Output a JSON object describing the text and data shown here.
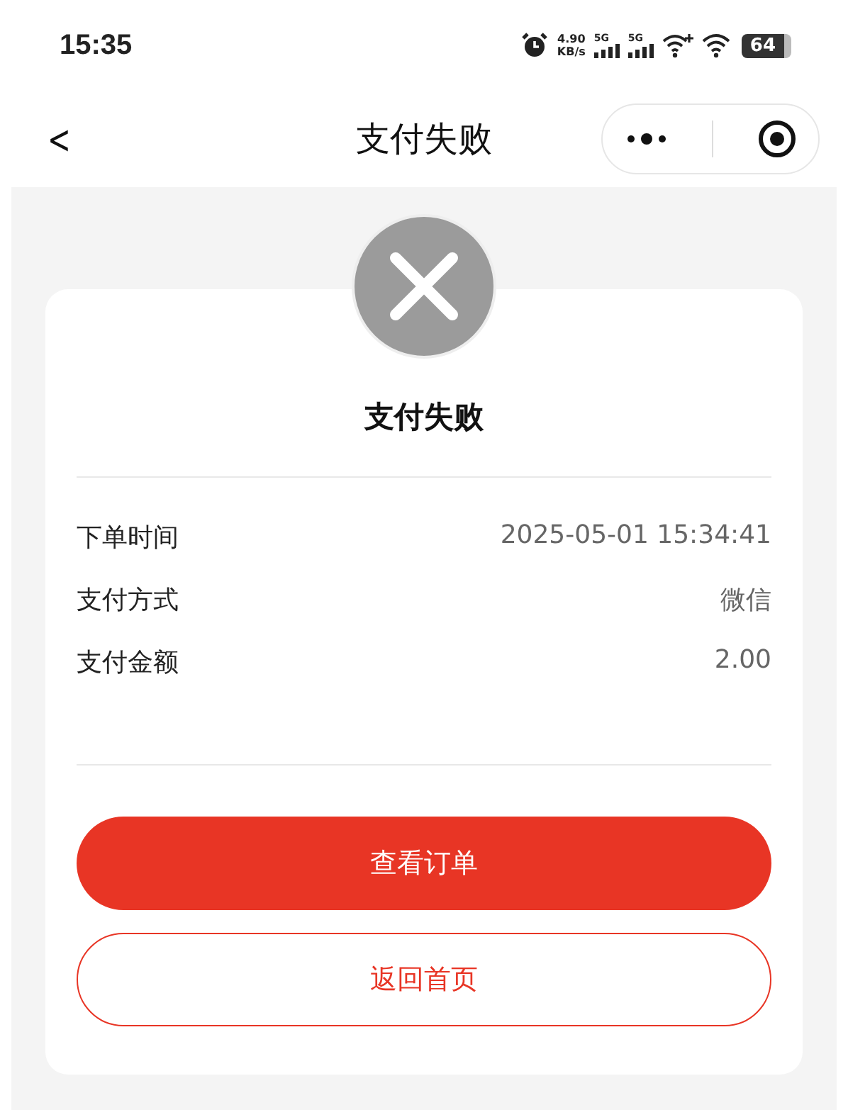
{
  "status_bar": {
    "time": "15:35",
    "speed_value": "4.90",
    "speed_unit": "KB/s",
    "network_1": "5G",
    "network_2": "5G",
    "battery": "64"
  },
  "nav_bar": {
    "back": "<",
    "title": "支付失败"
  },
  "result": {
    "title": "支付失败",
    "details": [
      {
        "label": "下单时间",
        "value": "2025-05-01 15:34:41"
      },
      {
        "label": "支付方式",
        "value": "微信"
      },
      {
        "label": "支付金额",
        "value": "2.00"
      }
    ],
    "buttons": [
      {
        "label": "查看订单",
        "kind": "primary"
      },
      {
        "label": "返回首页",
        "kind": "outline"
      }
    ]
  }
}
